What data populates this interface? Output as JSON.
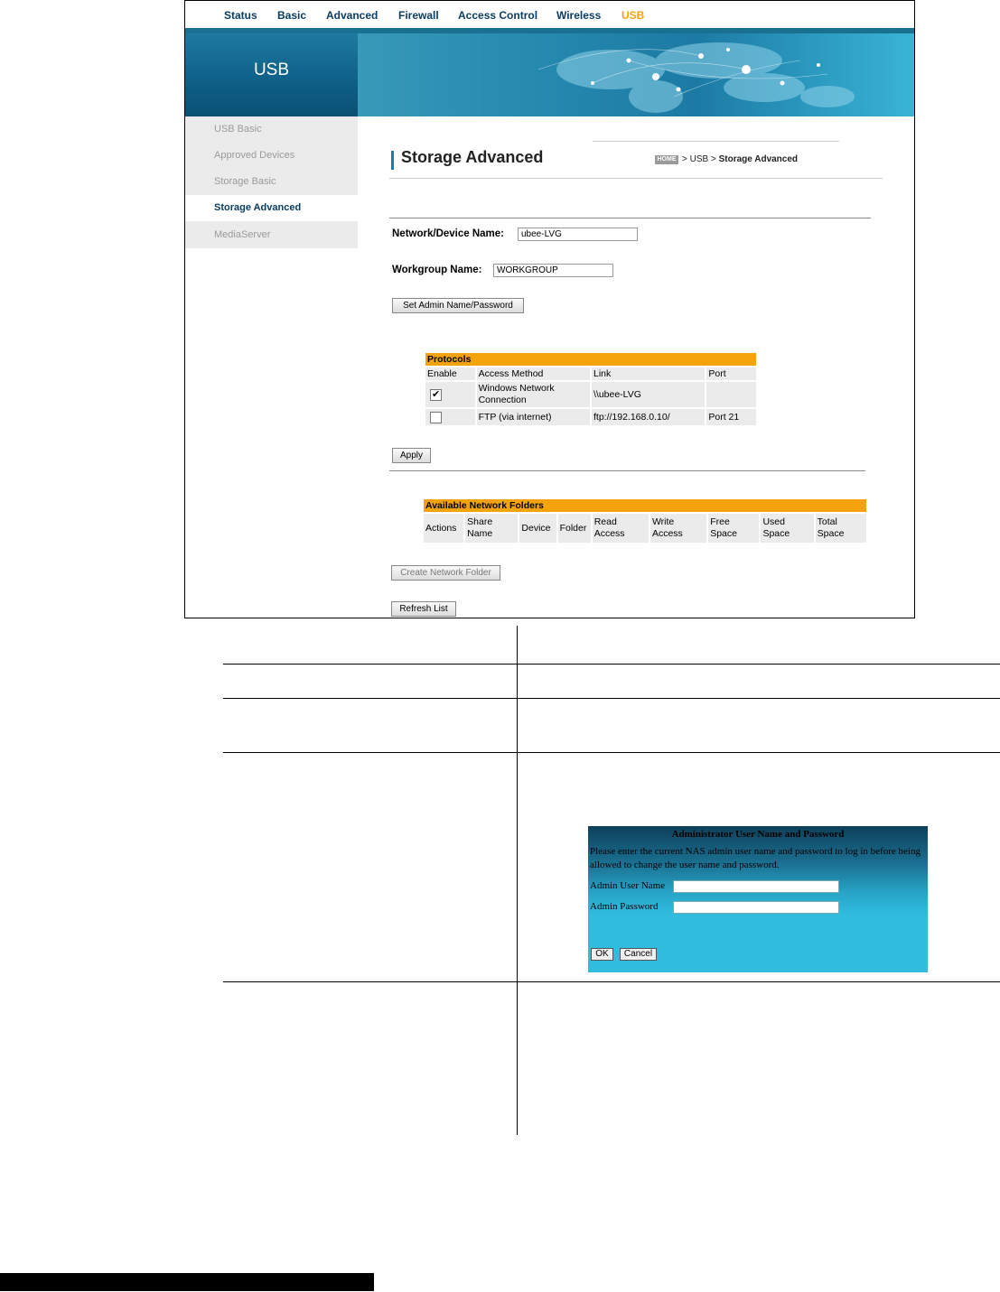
{
  "nav": {
    "items": [
      "Status",
      "Basic",
      "Advanced",
      "Firewall",
      "Access Control",
      "Wireless",
      "USB"
    ],
    "active_index": 6
  },
  "banner": {
    "section_title": "USB"
  },
  "sidebar": {
    "items": [
      "USB Basic",
      "Approved Devices",
      "Storage Basic",
      "Storage Advanced",
      "MediaServer"
    ],
    "active_index": 3
  },
  "page": {
    "title": "Storage Advanced",
    "breadcrumb": {
      "home": "HOME",
      "parent": "> USB >",
      "current": "Storage Advanced"
    }
  },
  "form": {
    "device_name_label": "Network/Device Name:",
    "device_name_value": "ubee-LVG",
    "workgroup_label": "Workgroup Name:",
    "workgroup_value": "WORKGROUP",
    "set_admin_button": "Set Admin Name/Password",
    "apply_button": "Apply"
  },
  "protocols": {
    "title": "Protocols",
    "columns": [
      "Enable",
      "Access Method",
      "Link",
      "Port"
    ],
    "rows": [
      {
        "enabled": true,
        "method": "Windows Network Connection",
        "link": "\\\\ubee-LVG",
        "port": ""
      },
      {
        "enabled": false,
        "method": "FTP (via internet)",
        "link": "ftp://192.168.0.10/",
        "port": "Port 21"
      }
    ]
  },
  "folders": {
    "title": "Available Network Folders",
    "columns": [
      "Actions",
      "Share Name",
      "Device",
      "Folder",
      "Read Access",
      "Write Access",
      "Free Space",
      "Used Space",
      "Total Space"
    ],
    "create_button": "Create Network Folder",
    "refresh_button": "Refresh List"
  },
  "dialog": {
    "title": "Administrator User Name and Password",
    "description": "Please enter the current NAS admin user name and password to log in before being allowed to change the user name and password.",
    "username_label": "Admin User Name",
    "password_label": "Admin Password",
    "ok_button": "OK",
    "cancel_button": "Cancel"
  },
  "colors": {
    "accent_orange": "#f5a30a",
    "nav_blue": "#0b3d63",
    "banner_blue": "#1c7aa4"
  }
}
